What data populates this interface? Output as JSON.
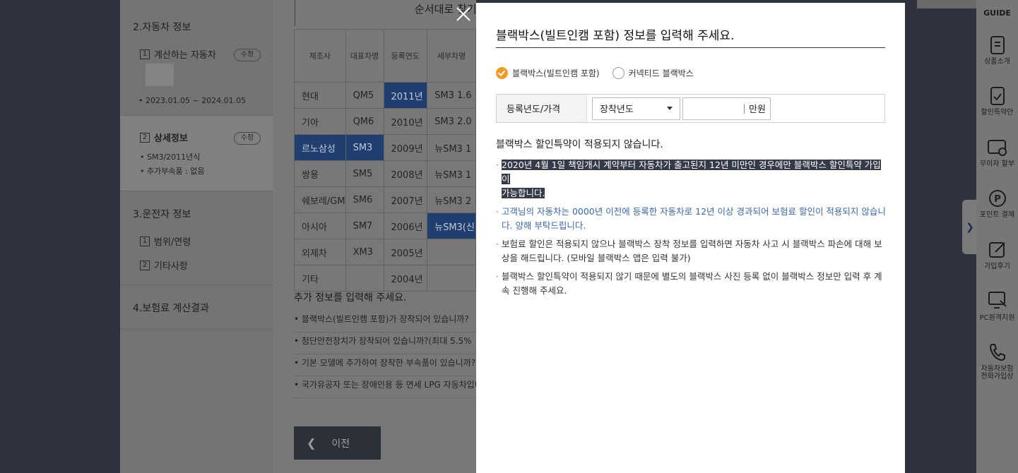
{
  "steps": {
    "section_car": "2.자동차 정보",
    "sub_car_label": "계산하는 자동차",
    "sub_car_num": "1",
    "edit_label": "수정",
    "period": "• 2023.01.05 ~ 2024.01.05",
    "sub_detail_num": "2",
    "sub_detail_label": "상세정보",
    "detail_model": "• SM3/2011년식",
    "detail_parts": "• 추가부속품 : 없음",
    "section_driver": "3.운전자 정보",
    "driver_sub1_num": "1",
    "driver_sub1": "범위/연령",
    "driver_sub2_num": "2",
    "driver_sub2": "기타사항",
    "section_result": "4.보험료 계산결과"
  },
  "car_table": {
    "title": "순서대로 찾기",
    "headers": [
      "제조사",
      "대표차명",
      "등록연도",
      "세부차명"
    ],
    "rows": [
      [
        "현대",
        "QM5",
        "2011년",
        "SM3 1.6"
      ],
      [
        "기아",
        "QM6",
        "2010년",
        "SM3 2.0"
      ],
      [
        "르노삼성",
        "SM3",
        "2009년",
        "뉴SM3 1"
      ],
      [
        "쌍용",
        "SM5",
        "2008년",
        "뉴SM3 1"
      ],
      [
        "쉐보레/GM",
        "SM6",
        "2007년",
        "뉴SM3 2"
      ],
      [
        "아시아",
        "SM7",
        "2006년",
        "뉴SM3(신"
      ],
      [
        "외제차",
        "XM3",
        "2005년",
        ""
      ],
      [
        "기타",
        "",
        "2004년",
        ""
      ]
    ]
  },
  "additional": {
    "title": "추가 정보를 입력해 주세요.",
    "questions": [
      "• 블랙박스(빌트인캠 포함)가 장착되어 있습니까?",
      "• 첨단안전장치가 장착되어 있습니까?(최대 5.5%",
      "• 기본 모델에 추가하여 장착한 부속품이 있습니까?",
      "• 국가유공자 또는 장애인용 등 면세 LPG 자동차입니"
    ],
    "prev_label": "이전"
  },
  "guide": {
    "title": "GUIDE",
    "items": [
      "상품소개",
      "할인특약안",
      "무이자 할부",
      "포인트 결제",
      "가입후기",
      "PC원격지원",
      "자동차보험",
      "전화가입상"
    ]
  },
  "modal": {
    "title": "블랙박스(빌트인캠 포함) 정보를 입력해 주세요.",
    "radio_builtin": "블랙박스(빌트인캠 포함)",
    "radio_connected": "커넥티드 블랙박스",
    "reg_label": "등록년도/가격",
    "reg_select_value": "장착년도",
    "price_value": "",
    "price_unit": "만원",
    "notice": "블랙박스 할인특약이 적용되지 않습니다.",
    "bullet_highlight_1": "2020년 4월 1일 책임개시 계약부터 자동차가 출고된지 12년 미만인 경우에만 블랙박스 할인특약 가입이",
    "bullet_highlight_2": "가능합니다.",
    "bullet_blue": "고객님의 자동차는 0000년 이전에 등록한 자동차로 12년 이상 경과되어 보험료 할인이 적용되지 않습니다. 양해 부탁드립니다.",
    "bullet_3": "보험료 할인은 적용되지 않으나 블랙박스 장착 정보를 입력하면 자동차 사고 시 블랙박스 파손에 대해 보상을 해드립니다. (모바일 블랙박스 앱은 입력 불가)",
    "bullet_4": "블랙박스 할인특약이 적용되지 않기 때문에 별도의 블랙박스 사진 등록 없이 블랙박스 정보만 입력 후 계속 진행해 주세요."
  },
  "colors": {
    "accent_orange": "#f39a26",
    "highlight_bg": "#343a48",
    "info_blue": "#3a68a8",
    "selected_cell": "#213f6e"
  }
}
